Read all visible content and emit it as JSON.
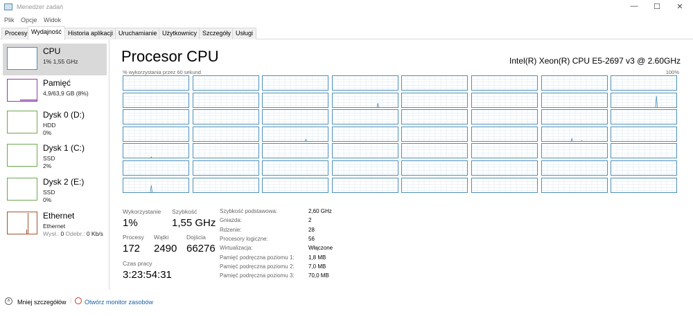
{
  "window": {
    "title": "Menedżer zadań",
    "minimize": "—",
    "maximize": "☐",
    "close": "✕"
  },
  "menu": [
    "Plik",
    "Opcje",
    "Widok"
  ],
  "tabs": [
    "Procesy",
    "Wydajność",
    "Historia aplikacji",
    "Uruchamianie",
    "Użytkownicy",
    "Szczegóły",
    "Usługi"
  ],
  "sidebar": {
    "cpu": {
      "name": "CPU",
      "line1": "1% 1,55 GHz",
      "color": "#4e8fb8"
    },
    "memory": {
      "name": "Pamięć",
      "line1": "4,9/63,9 GB (8%)",
      "color": "#8b3fa8"
    },
    "disk0": {
      "name": "Dysk 0 (D:)",
      "line1": "HDD",
      "line2": "0%",
      "color": "#6aa84f"
    },
    "disk1": {
      "name": "Dysk 1 (C:)",
      "line1": "SSD",
      "line2": "2%",
      "color": "#6aa84f"
    },
    "disk2": {
      "name": "Dysk 2 (E:)",
      "line1": "SSD",
      "line2": "0%",
      "color": "#6aa84f"
    },
    "ethernet": {
      "name": "Ethernet",
      "line1": "Ethernet",
      "sent_label": "Wysł.:",
      "sent": "0",
      "recv_label": "Odebr.:",
      "recv": "0 Kb/s",
      "color": "#a0522d"
    }
  },
  "main": {
    "title": "Procesor CPU",
    "model": "Intel(R) Xeon(R) CPU E5-2697 v3 @ 2.60GHz",
    "graph_label": "% wykorzystania przez 60 sekund",
    "graph_max": "100%",
    "logical_processors": 56,
    "spikes": [
      {
        "cell": 11,
        "pos": 0.68,
        "value": 35
      },
      {
        "cell": 15,
        "pos": 0.68,
        "value": 85
      },
      {
        "cell": 26,
        "pos": 0.65,
        "value": 20
      },
      {
        "cell": 30,
        "pos": 0.45,
        "value": 25
      },
      {
        "cell": 30,
        "pos": 0.6,
        "value": 10
      },
      {
        "cell": 32,
        "pos": 0.42,
        "value": 12
      },
      {
        "cell": 48,
        "pos": 0.42,
        "value": 55
      },
      {
        "cell": 6,
        "pos": 0.5,
        "value": 4
      },
      {
        "cell": 10,
        "pos": 0.5,
        "value": 4
      }
    ],
    "stats": {
      "usage_label": "Wykorzystanie",
      "usage": "1%",
      "speed_label": "Szybkość",
      "speed": "1,55 GHz",
      "processes_label": "Procesy",
      "processes": "172",
      "threads_label": "Wątki",
      "threads": "2490",
      "handles_label": "Dojścia",
      "handles": "66276",
      "uptime_label": "Czas pracy",
      "uptime": "3:23:54:31"
    },
    "details": [
      {
        "k": "Szybkość podstawowa:",
        "v": "2,60 GHz"
      },
      {
        "k": "Gniazda:",
        "v": "2"
      },
      {
        "k": "Rdzenie:",
        "v": "28"
      },
      {
        "k": "Procesory logiczne:",
        "v": "56"
      },
      {
        "k": "Wirtualizacja:",
        "v": "Włączone"
      },
      {
        "k": "Pamięć podręczna poziomu 1:",
        "v": "1,8 MB"
      },
      {
        "k": "Pamięć podręczna poziomu 2:",
        "v": "7,0 MB"
      },
      {
        "k": "Pamięć podręczna poziomu 3:",
        "v": "70,0 MB"
      }
    ]
  },
  "footer": {
    "fewer": "Mniej szczegółów",
    "monitor": "Otwórz monitor zasobów"
  }
}
